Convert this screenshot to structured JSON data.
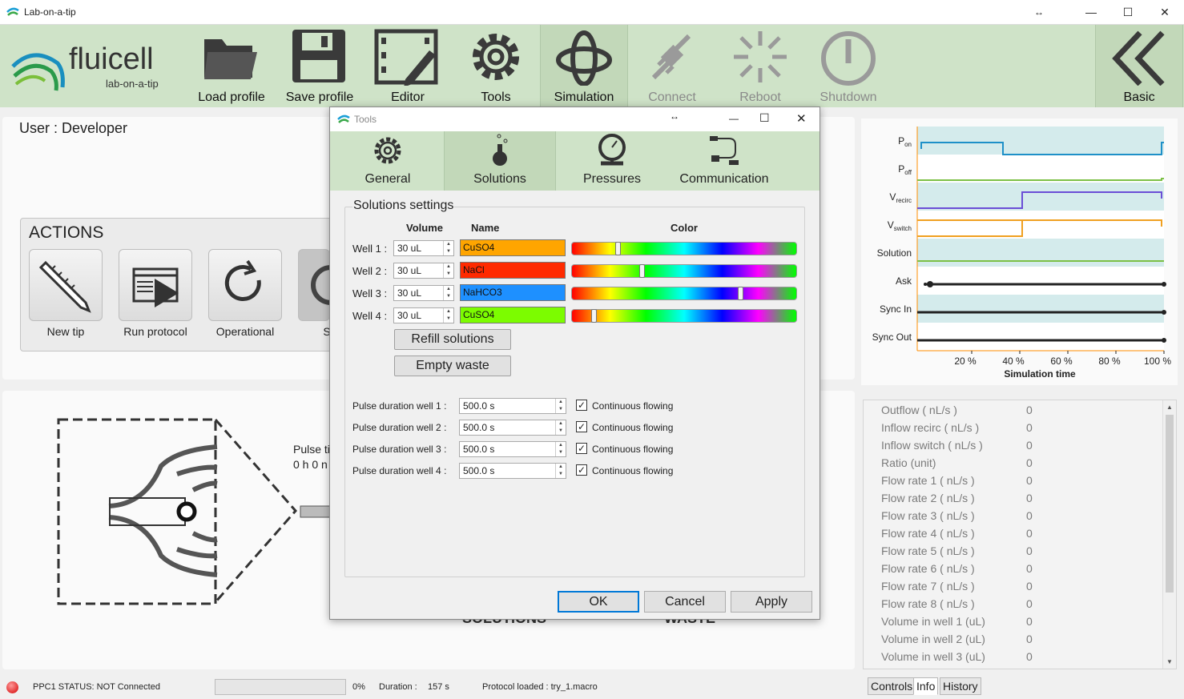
{
  "app": {
    "title": "Lab-on-a-tip",
    "logo_name": "fluicell",
    "logo_tagline": "lab-on-a-tip"
  },
  "toolbar": {
    "load_profile": "Load profile",
    "save_profile": "Save profile",
    "editor": "Editor",
    "tools": "Tools",
    "simulation": "Simulation",
    "connect": "Connect",
    "reboot": "Reboot",
    "shutdown": "Shutdown",
    "basic": "Basic"
  },
  "user": {
    "label": "User : Developer"
  },
  "actions": {
    "title": "ACTIONS",
    "new_tip": "New tip",
    "run_protocol": "Run protocol",
    "operational": "Operational",
    "partial": "S"
  },
  "diagram": {
    "pulse_label": "Pulse ti",
    "pulse_value": "0 h 0 n",
    "solutions": "SOLUTIONS",
    "waste": "WASTE"
  },
  "status": {
    "ppc1": "PPC1 STATUS: NOT Connected",
    "progress_percent": "0%",
    "progress_value": 0,
    "duration_label": "Duration :",
    "duration_value": "157 s",
    "protocol": "Protocol loaded : try_1.macro"
  },
  "timing": {
    "signals": [
      "Pon",
      "Poff",
      "Vrecirc",
      "Vswitch",
      "Solution",
      "Ask",
      "Sync In",
      "Sync Out"
    ],
    "signal_main": [
      "P",
      "P",
      "V",
      "V"
    ],
    "signal_sub": [
      "on",
      "off",
      "recirc",
      "switch"
    ],
    "xticks": [
      "20 %",
      "40 %",
      "60 %",
      "80 %",
      "100 %"
    ],
    "xlabel": "Simulation time"
  },
  "info": {
    "rows": [
      {
        "label": "Outflow ( nL/s )",
        "value": "0"
      },
      {
        "label": "Inflow recirc ( nL/s )",
        "value": "0"
      },
      {
        "label": "Inflow switch ( nL/s )",
        "value": "0"
      },
      {
        "label": "Ratio (unit)",
        "value": "0"
      },
      {
        "label": "Flow rate 1 ( nL/s )",
        "value": "0"
      },
      {
        "label": "Flow rate 2 ( nL/s )",
        "value": "0"
      },
      {
        "label": "Flow rate 3 ( nL/s )",
        "value": "0"
      },
      {
        "label": "Flow rate 4 ( nL/s )",
        "value": "0"
      },
      {
        "label": "Flow rate 5 ( nL/s )",
        "value": "0"
      },
      {
        "label": "Flow rate 6 ( nL/s )",
        "value": "0"
      },
      {
        "label": "Flow rate 7 ( nL/s )",
        "value": "0"
      },
      {
        "label": "Flow rate 8 ( nL/s )",
        "value": "0"
      },
      {
        "label": "Volume in well 1 (uL)",
        "value": "0"
      },
      {
        "label": "Volume in well 2 (uL)",
        "value": "0"
      },
      {
        "label": "Volume in well 3 (uL)",
        "value": "0"
      }
    ],
    "tabs": [
      "Controls",
      "Info",
      "History"
    ]
  },
  "dialog": {
    "title": "Tools",
    "tabs": [
      "General",
      "Solutions",
      "Pressures",
      "Communication"
    ],
    "group_title": "Solutions settings",
    "col_volume": "Volume",
    "col_name": "Name",
    "col_color": "Color",
    "wells": [
      {
        "label": "Well 1 :",
        "volume": "30  uL",
        "name": "CuSO4",
        "color": "#ffa500",
        "slider": 0.2
      },
      {
        "label": "Well 2 :",
        "volume": "30  uL",
        "name": "NaCl",
        "color": "#ff2a00",
        "slider": 0.31
      },
      {
        "label": "Well 3 :",
        "volume": "30  uL",
        "name": "NaHCO3",
        "color": "#1e90ff",
        "slider": 0.76
      },
      {
        "label": "Well 4 :",
        "volume": "30  uL",
        "name": "CuSO4",
        "color": "#7cfc00",
        "slider": 0.09
      }
    ],
    "refill": "Refill solutions",
    "empty": "Empty waste",
    "pulses": [
      {
        "label": "Pulse duration well 1 :",
        "value": "500.0 s",
        "check": "Continuous flowing",
        "checked": true
      },
      {
        "label": "Pulse duration well 2 :",
        "value": "500.0 s",
        "check": "Continuous flowing",
        "checked": true
      },
      {
        "label": "Pulse duration well 3 :",
        "value": "500.0 s",
        "check": "Continuous flowing",
        "checked": true
      },
      {
        "label": "Pulse duration well 4 :",
        "value": "500.0 s",
        "check": "Continuous flowing",
        "checked": true
      }
    ],
    "ok": "OK",
    "cancel": "Cancel",
    "apply": "Apply"
  }
}
